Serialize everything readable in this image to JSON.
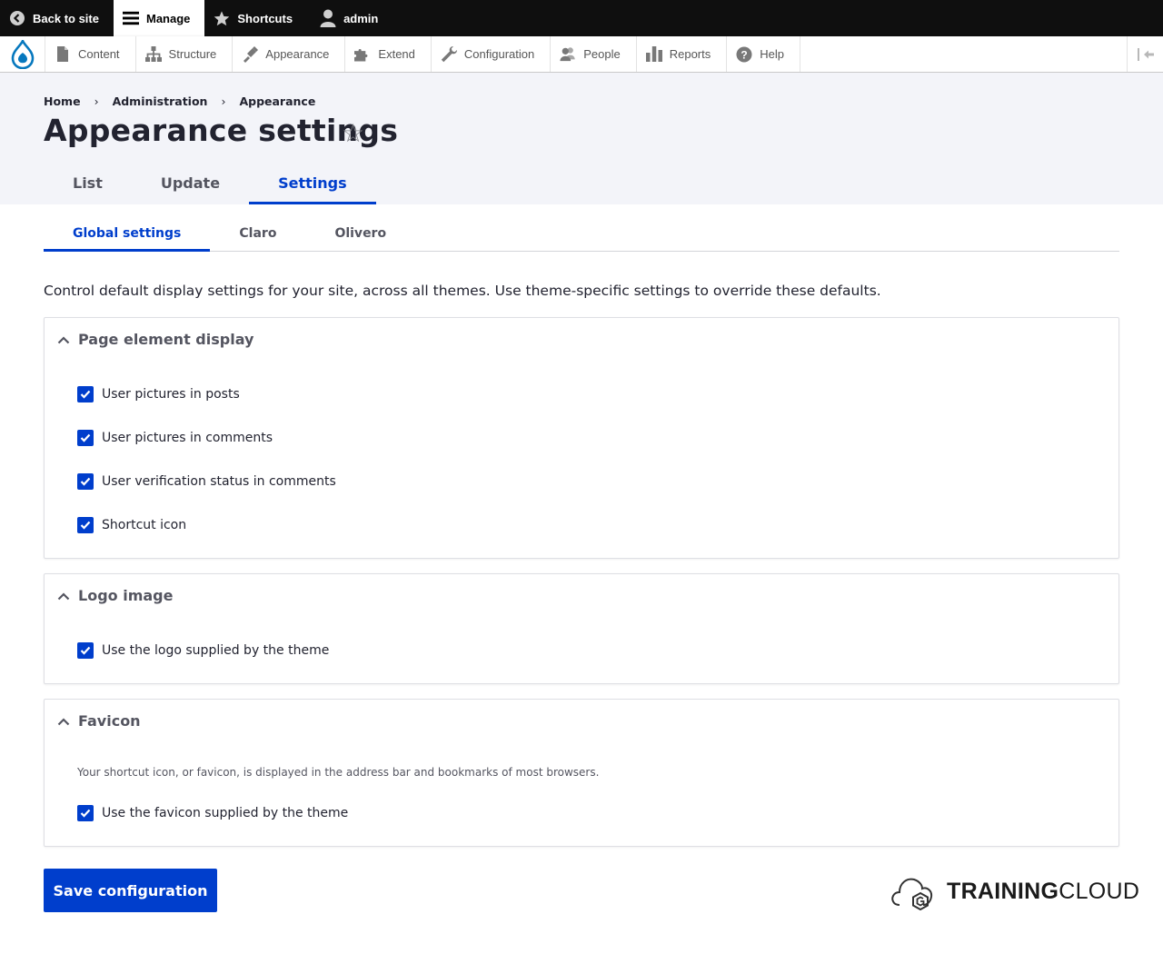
{
  "toolbar": {
    "back_to_site": "Back to site",
    "manage": "Manage",
    "shortcuts": "Shortcuts",
    "user": "admin"
  },
  "admin_menu": {
    "items": [
      {
        "label": "Content",
        "icon": "file-icon"
      },
      {
        "label": "Structure",
        "icon": "sitemap-icon"
      },
      {
        "label": "Appearance",
        "icon": "paintbrush-icon"
      },
      {
        "label": "Extend",
        "icon": "puzzle-icon"
      },
      {
        "label": "Configuration",
        "icon": "wrench-icon"
      },
      {
        "label": "People",
        "icon": "people-icon"
      },
      {
        "label": "Reports",
        "icon": "bar-chart-icon"
      },
      {
        "label": "Help",
        "icon": "help-icon"
      }
    ]
  },
  "breadcrumb": [
    "Home",
    "Administration",
    "Appearance"
  ],
  "breadcrumb_separator": "›",
  "page": {
    "title": "Appearance settings",
    "star": "☆"
  },
  "primary_tabs": [
    "List",
    "Update",
    "Settings"
  ],
  "secondary_tabs": [
    "Global settings",
    "Claro",
    "Olivero"
  ],
  "intro": "Control default display settings for your site, across all themes. Use theme-specific settings to override these defaults.",
  "fieldsets": {
    "page_element_display": {
      "title": "Page element display",
      "items": [
        {
          "label": "User pictures in posts",
          "checked": true
        },
        {
          "label": "User pictures in comments",
          "checked": true
        },
        {
          "label": "User verification status in comments",
          "checked": true
        },
        {
          "label": "Shortcut icon",
          "checked": true
        }
      ]
    },
    "logo_image": {
      "title": "Logo image",
      "items": [
        {
          "label": "Use the logo supplied by the theme",
          "checked": true
        }
      ]
    },
    "favicon": {
      "title": "Favicon",
      "description": "Your shortcut icon, or favicon, is displayed in the address bar and bookmarks of most browsers.",
      "items": [
        {
          "label": "Use the favicon supplied by the theme",
          "checked": true
        }
      ]
    }
  },
  "save_label": "Save configuration",
  "brand": {
    "bold": "TRAINING",
    "light": "CLOUD"
  },
  "colors": {
    "accent": "#003ecc",
    "toolbar_bg": "#0f0f0f",
    "header_bg": "#f3f4f9",
    "drupal_blue": "#0678be"
  }
}
